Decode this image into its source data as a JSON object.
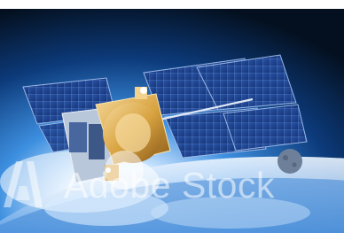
{
  "image": {
    "subject": "satellite-over-earth",
    "colors": {
      "space": "#04101f",
      "atmosphere": "#3d8fe0",
      "glow": "#ffffff",
      "panel": "#1d3f8a",
      "panel_grid": "#7fa6dd",
      "gold_foil": "#d9a441"
    }
  },
  "watermark": {
    "text": "Adobe Stock",
    "logo": "adobe-logo"
  }
}
